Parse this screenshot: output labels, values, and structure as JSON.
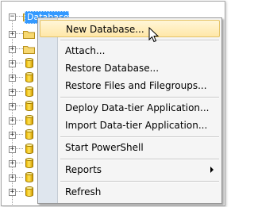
{
  "tree": {
    "selected_node_label": "Databases"
  },
  "context_menu": {
    "items": [
      {
        "label": "New Database..."
      },
      {
        "label": "Attach..."
      },
      {
        "label": "Restore Database..."
      },
      {
        "label": "Restore Files and Filegroups..."
      },
      {
        "label": "Deploy Data-tier Application..."
      },
      {
        "label": "Import Data-tier Application..."
      },
      {
        "label": "Start PowerShell"
      },
      {
        "label": "Reports"
      },
      {
        "label": "Refresh"
      }
    ]
  },
  "colors": {
    "selection": "#3399ff",
    "menu_highlight": "#ffe7a8",
    "menu_background": "#f5f5f5",
    "gutter": "#dfe6ee"
  },
  "icons": {
    "expander": "plus-box-icon",
    "folder": "folder-icon",
    "database": "database-cylinder-icon",
    "submenu": "submenu-arrow-icon",
    "cursor": "mouse-pointer-icon"
  }
}
